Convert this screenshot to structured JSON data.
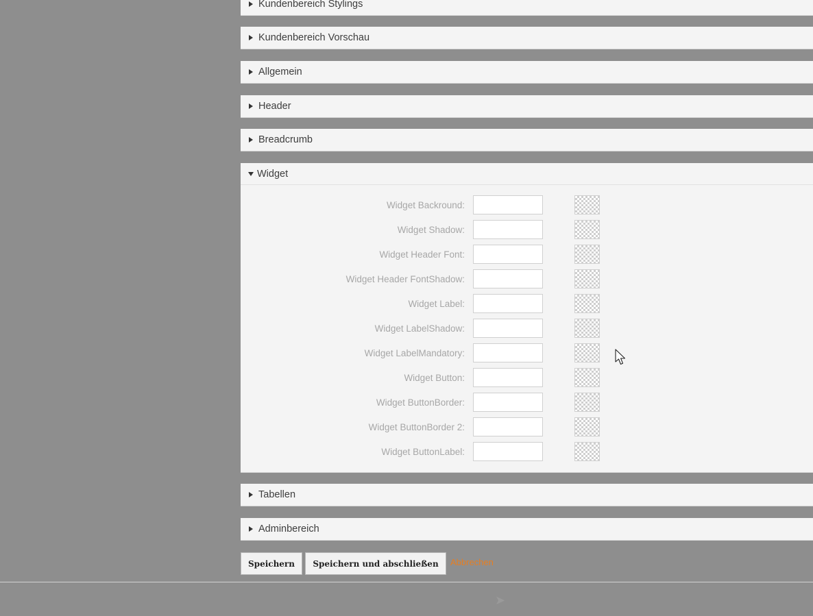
{
  "sections": {
    "kundenbereich_stylings": "Kundenbereich Stylings",
    "kundenbereich_vorschau": "Kundenbereich Vorschau",
    "allgemein": "Allgemein",
    "header": "Header",
    "breadcrumb": "Breadcrumb",
    "widget": "Widget",
    "tabellen": "Tabellen",
    "adminbereich": "Adminbereich"
  },
  "widget_fields": [
    {
      "label": "Widget Backround:",
      "value": ""
    },
    {
      "label": "Widget Shadow:",
      "value": ""
    },
    {
      "label": "Widget Header Font:",
      "value": ""
    },
    {
      "label": "Widget Header FontShadow:",
      "value": ""
    },
    {
      "label": "Widget Label:",
      "value": ""
    },
    {
      "label": "Widget LabelShadow:",
      "value": ""
    },
    {
      "label": "Widget LabelMandatory:",
      "value": ""
    },
    {
      "label": "Widget Button:",
      "value": ""
    },
    {
      "label": "Widget ButtonBorder:",
      "value": ""
    },
    {
      "label": "Widget ButtonBorder 2:",
      "value": ""
    },
    {
      "label": "Widget ButtonLabel:",
      "value": ""
    }
  ],
  "actions": {
    "save": "Speichern",
    "save_close": "Speichern und abschließen",
    "cancel": "Abbrechen"
  },
  "footer": {
    "arrow_glyph": "➤"
  },
  "colors": {
    "backdrop": "#8e8e8e",
    "panel": "#f4f4f4",
    "cancel_link": "#e67e22",
    "label": "#a7a7a7"
  },
  "icons": {
    "collapsed": "triangle-right-icon",
    "expanded": "triangle-down-icon",
    "swatch": "transparent-color-swatch",
    "cursor": "mouse-pointer-icon"
  }
}
